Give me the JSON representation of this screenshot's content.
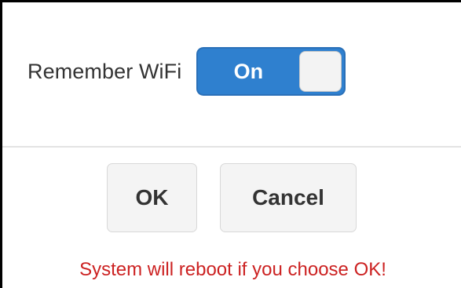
{
  "setting": {
    "label": "Remember WiFi",
    "toggle_state": "On",
    "toggle_on": true
  },
  "buttons": {
    "ok_label": "OK",
    "cancel_label": "Cancel"
  },
  "warning": "System will reboot if you choose OK!",
  "colors": {
    "toggle_on": "#2f80cf",
    "warning_text": "#cc2222",
    "button_bg": "#f4f4f4"
  }
}
